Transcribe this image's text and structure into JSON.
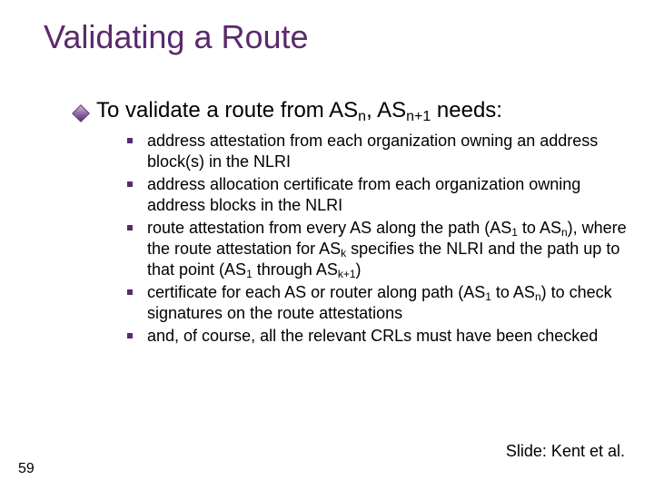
{
  "title": "Validating a Route",
  "lead_prefix": "To validate a route from AS",
  "lead_sub1": "n",
  "lead_mid": ", AS",
  "lead_sub2": "n+1",
  "lead_suffix": " needs:",
  "items": [
    "address attestation from each organization owning an address block(s) in the NLRI",
    "address allocation certificate from each organization owning address blocks in the NLRI",
    "route attestation from every AS along the path (AS<sub>1</sub> to AS<sub>n</sub>), where the route attestation for AS<sub>k</sub> specifies the NLRI and the path up to that point (AS<sub>1</sub> through AS<sub>k+1</sub>)",
    "certificate for each AS or router along path (AS<sub>1</sub> to AS<sub>n</sub>) to check signatures on the route attestations",
    "and, of course, all the relevant CRLs must have been checked"
  ],
  "slide_number": "59",
  "attribution": "Slide: Kent et al."
}
